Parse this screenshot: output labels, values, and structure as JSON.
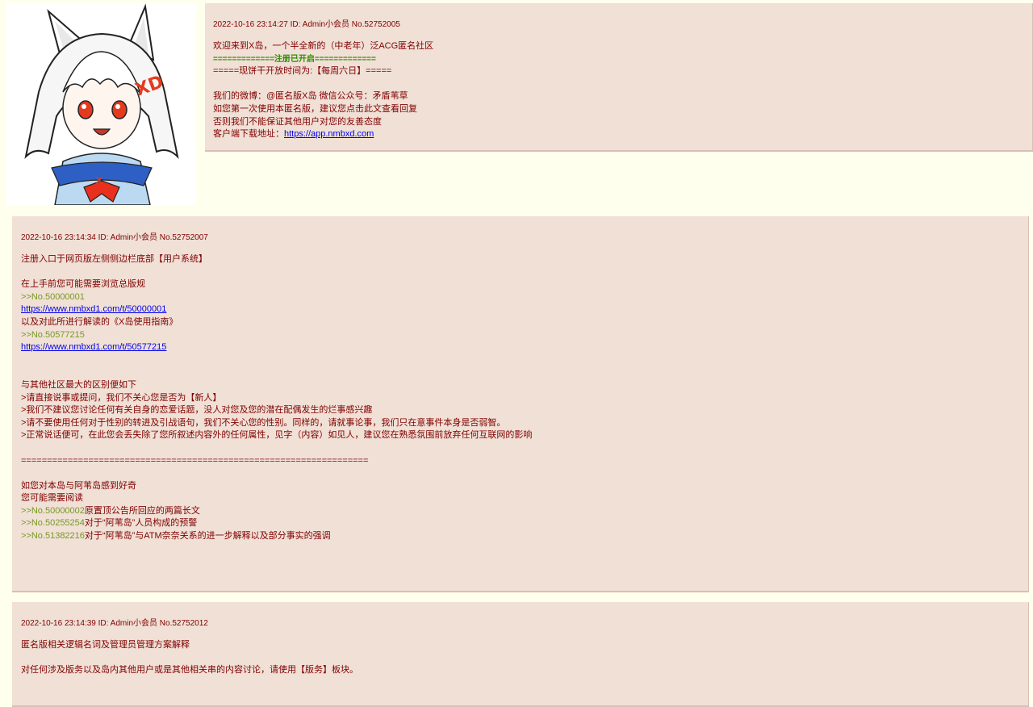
{
  "op": {
    "avatar_icon": "fox-girl-mascot-icon",
    "avatar_label": "XD",
    "meta": {
      "date": "2022-10-16",
      "time": "23:14:27",
      "id_text": "ID: Admin小会员",
      "no": "No.52752005"
    },
    "lines": {
      "welcome": "欢迎来到X岛，一个半全新的（中老年）泛ACG匿名社区",
      "register_open": "=============注册已开启=============",
      "cookie_time": "=====现饼干开放时间为:【每周六日】=====",
      "weibo": "我们的微博：@匿名版X岛 微信公众号：矛盾苇草",
      "first_time": "如您第一次使用本匿名版，建议您点击此文查看回复",
      "otherwise": "否则我们不能保证其他用户对您的友善态度",
      "client_prefix": "客户端下载地址：",
      "client_url": "https://app.nmbxd.com"
    }
  },
  "reply1": {
    "meta": {
      "date": "2022-10-16",
      "time": "23:14:34",
      "id_text": "ID: Admin小会员",
      "no": "No.52752007"
    },
    "lines": {
      "l1": "注册入口于网页版左侧侧边栏底部【用户系统】",
      "l2": "在上手前您可能需要浏览总版规",
      "q1": ">>No.50000001",
      "u1": "https://www.nmbxd1.com/t/50000001",
      "l3": "以及对此所进行解读的《X岛使用指南》",
      "q2": ">>No.50577215",
      "u2": "https://www.nmbxd1.com/t/50577215",
      "l4": "与其他社区最大的区别便如下",
      "l5": ">请直接说事或提问，我们不关心您是否为【新人】",
      "l6": ">我们不建议您讨论任何有关自身的恋爱话题，没人对您及您的潜在配偶发生的烂事感兴趣",
      "l7": ">请不要使用任何对于性别的转进及引战语句，我们不关心您的性别。同样的，请就事论事，我们只在意事件本身是否弱智。",
      "l8": ">正常说话便可，在此您会丢失除了您所叙述内容外的任何属性，见字（内容）如见人，建议您在熟悉氛围前放弃任何互联网的影响",
      "sep": "===================================================================",
      "l9": "如您对本岛与阿苇岛感到好奇",
      "l10": "您可能需要阅读",
      "q3": ">>No.50000002",
      "t3": "原置顶公告所回应的两篇长文",
      "q4": ">>No.50255254",
      "t4": "对于“阿苇岛”人员构成的预警",
      "q5": ">>No.51382216",
      "t5": "对于“阿苇岛”与ATM奈奈关系的进一步解释以及部分事实的强调"
    }
  },
  "reply2": {
    "meta": {
      "date": "2022-10-16",
      "time": "23:14:39",
      "id_text": "ID: Admin小会员",
      "no": "No.52752012"
    },
    "lines": {
      "l1": "匿名版相关逻辑名词及管理员管理方案解释",
      "l2": "对任何涉及版务以及岛内其他用户或是其他相关串的内容讨论，请使用【版务】板块。"
    }
  },
  "colors": {
    "page_bg": "#ffffee",
    "card_bg": "#f0e0d6",
    "text": "#800000",
    "quote": "#789922",
    "green_notice": "#2e8b00",
    "link": "#0000ee"
  }
}
